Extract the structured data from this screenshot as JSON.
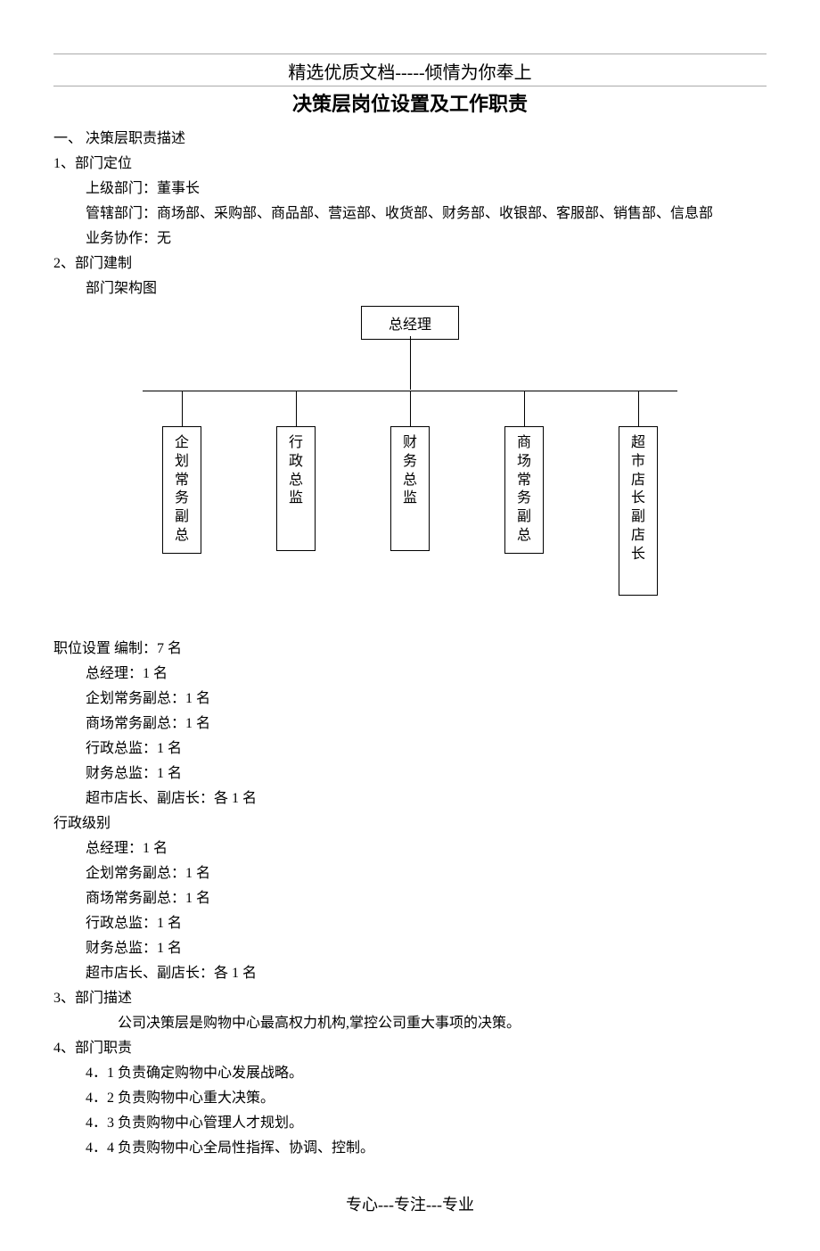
{
  "header_line": "精选优质文档-----倾情为你奉上",
  "doc_title": "决策层岗位设置及工作职责",
  "s1_title": "一、 决策层职责描述",
  "s1_1": "1、部门定位",
  "s1_1_a": "上级部门：董事长",
  "s1_1_b": "管辖部门：商场部、采购部、商品部、营运部、收货部、财务部、收银部、客服部、销售部、信息部",
  "s1_1_c": "业务协作：无",
  "s1_2": "2、部门建制",
  "s1_2_a": "部门架构图",
  "chart_data": {
    "type": "org-chart",
    "root": "总经理",
    "children": [
      "企划常务副总",
      "行政总监",
      "财务总监",
      "商场常务副总",
      "超市店长副店长"
    ]
  },
  "pos_title": "职位设置 编制：7 名",
  "pos_1": "总经理：1 名",
  "pos_2": "企划常务副总：1 名",
  "pos_3": "商场常务副总：1 名",
  "pos_4": "行政总监：1 名",
  "pos_5": "财务总监：1 名",
  "pos_6": "超市店长、副店长：各 1 名",
  "lvl_title": "行政级别",
  "lvl_1": "总经理：1 名",
  "lvl_2": "企划常务副总：1 名",
  "lvl_3": "商场常务副总：1 名",
  "lvl_4": "行政总监：1 名",
  "lvl_5": "财务总监：1 名",
  "lvl_6": "超市店长、副店长：各 1 名",
  "s1_3": "3、部门描述",
  "s1_3_a": "公司决策层是购物中心最高权力机构,掌控公司重大事项的决策。",
  "s1_4": "4、部门职责",
  "s1_4_1": "4．1 负责确定购物中心发展战略。",
  "s1_4_2": "4．2 负责购物中心重大决策。",
  "s1_4_3": "4．3 负责购物中心管理人才规划。",
  "s1_4_4": "4．4 负责购物中心全局性指挥、协调、控制。",
  "footer": "专心---专注---专业"
}
